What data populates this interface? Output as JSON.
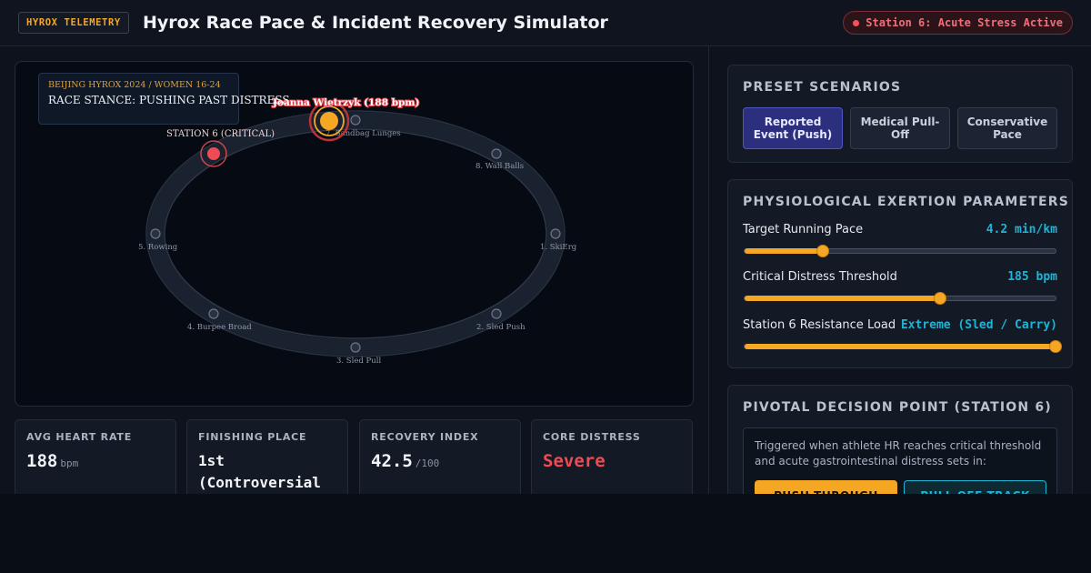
{
  "header": {
    "brand_badge": "HYROX TELEMETRY",
    "title": "Hyrox Race Pace & Incident Recovery Simulator",
    "status": "Station 6: Acute Stress Active"
  },
  "track": {
    "event_subtitle": "BEIJING HYROX 2024 / WOMEN 16-24",
    "race_stance": "RACE STANCE: PUSHING PAST DISTRESS",
    "runner_label": "Joanna Wietrzyk (188 bpm)",
    "critical_label": "STATION 6 (CRITICAL)",
    "stations": [
      "1. SkiErg",
      "2. Sled Push",
      "3. Sled Pull",
      "4. Burpee Broad",
      "5. Rowing",
      "7. Sandbag Lunges",
      "8. Wall Balls"
    ],
    "colors": {
      "runner": "#f5a623",
      "critical": "#ef4b54",
      "track": "#1c2432"
    }
  },
  "stats": [
    {
      "label": "AVG HEART RATE",
      "value": "188",
      "unit": "bpm"
    },
    {
      "label": "FINISHING PLACE",
      "value": "1st (Controversial"
    },
    {
      "label": "RECOVERY INDEX",
      "value": "42.5",
      "unit": "/100"
    },
    {
      "label": "CORE DISTRESS",
      "value": "Severe"
    }
  ],
  "presets": {
    "title": "PRESET SCENARIOS",
    "buttons": [
      "Reported Event (Push)",
      "Medical Pull-Off",
      "Conservative Pace"
    ],
    "active_index": 0
  },
  "params": {
    "title": "PHYSIOLOGICAL EXERTION PARAMETERS",
    "items": [
      {
        "label": "Target Running Pace",
        "value": "4.2 min/km",
        "level": 0.25
      },
      {
        "label": "Critical Distress Threshold",
        "value": "185 bpm",
        "level": 0.63
      },
      {
        "label": "Station 6 Resistance Load",
        "value": "Extreme (Sled / Carry)",
        "level": 1.0
      }
    ]
  },
  "decision": {
    "title": "PIVOTAL DECISION POINT (STATION 6)",
    "description": "Triggered when athlete HR reaches critical threshold and acute gastrointestinal distress sets in:",
    "push_label": "PUSH THROUGH",
    "pull_label": "PULL OFF TRACK"
  },
  "accent": {
    "orange": "#f5a623",
    "cyan": "#1bb5d6",
    "red": "#ef4b54",
    "indigo": "#2c2f7e"
  }
}
